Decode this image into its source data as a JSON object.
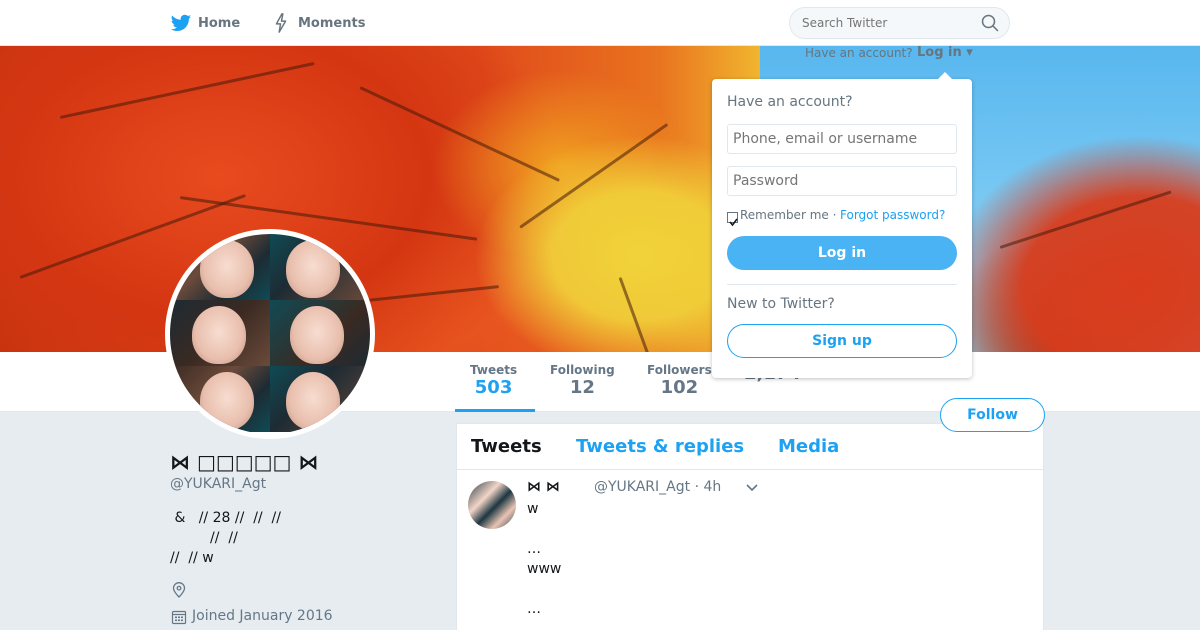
{
  "nav": {
    "home_label": "Home",
    "moments_label": "Moments",
    "search_placeholder": "Search Twitter"
  },
  "login_prompt": {
    "hint": "Have an account?",
    "link": "Log in ▾"
  },
  "dropdown": {
    "title": "Have an account?",
    "username_placeholder": "Phone, email or username",
    "password_placeholder": "Password",
    "remember_label": "Remember me ·",
    "forgot_label": "Forgot password?",
    "login_button": "Log in",
    "new_label": "New to Twitter?",
    "signup_button": "Sign up"
  },
  "stats": [
    {
      "label": "Tweets",
      "value": "503"
    },
    {
      "label": "Following",
      "value": "12"
    },
    {
      "label": "Followers",
      "value": "102"
    },
    {
      "label": "",
      "value": "2,174"
    }
  ],
  "follow_button": "Follow",
  "profile": {
    "name": "⋈ □□□□□ ⋈",
    "handle": "@YUKARI_Agt",
    "bio": " &   // 28 //  //  //\n         //  //\n//  // w",
    "joined": "Joined January 2016"
  },
  "timeline": {
    "tabs": [
      "Tweets",
      "Tweets & replies",
      "Media"
    ],
    "tweet": {
      "name": "⋈  ⋈",
      "handle": "@YUKARI_Agt · 4h",
      "text": "w\n\n…\nwww\n\n…"
    }
  },
  "colors": {
    "accent": "#1da1f2",
    "login_button": "#4ab3f4"
  }
}
